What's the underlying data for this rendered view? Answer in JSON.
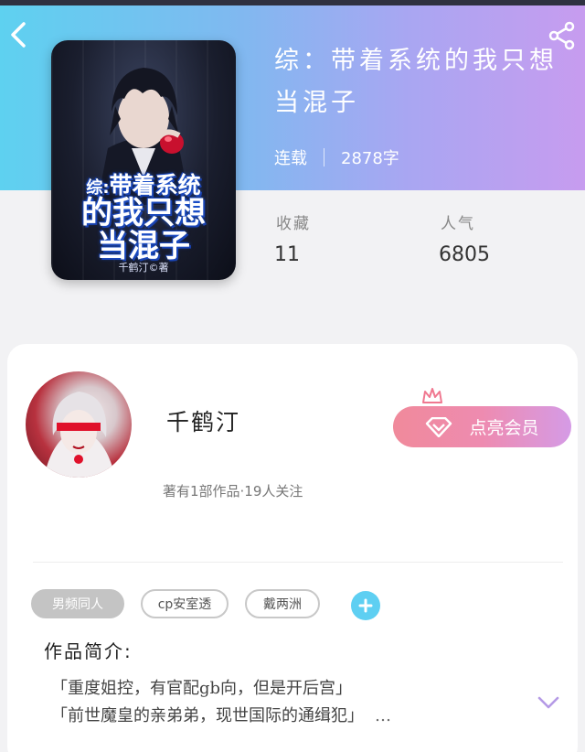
{
  "book": {
    "title": "综：带着系统的我只想当混子",
    "status": "连载",
    "word_count": "2878字",
    "cover": {
      "title_prefix": "综:",
      "title_line1": "带着系统",
      "title_line2": "的我只想",
      "title_line3": "当混子",
      "author": "千鹤汀©著"
    }
  },
  "stats": {
    "favorites_label": "收藏",
    "favorites_value": "11",
    "popularity_label": "人气",
    "popularity_value": "6805"
  },
  "author": {
    "name": "千鹤汀",
    "meta": "著有1部作品·19人关注",
    "vip_label": "点亮会员"
  },
  "tags": [
    "男频同人",
    "cp安室透",
    "戴两洲"
  ],
  "intro": {
    "heading": "作品简介:",
    "line1": "「重度姐控，有官配gb向，但是开后宫」",
    "line2": "「前世魔皇的亲弟弟，现世国际的通缉犯」",
    "ellipsis": "…"
  },
  "colors": {
    "hero_start": "#5ed1f0",
    "hero_end": "#c79cef",
    "vip_start": "#f08a9b",
    "vip_end": "#d59be6",
    "accent_blue": "#5ecff2",
    "expand_purple": "#b59ae6"
  },
  "icons": {
    "back": "chevron-left-icon",
    "share": "share-icon",
    "vip": "diamond-icon",
    "crown": "crown-icon",
    "add": "plus-icon",
    "expand": "chevron-down-icon"
  }
}
